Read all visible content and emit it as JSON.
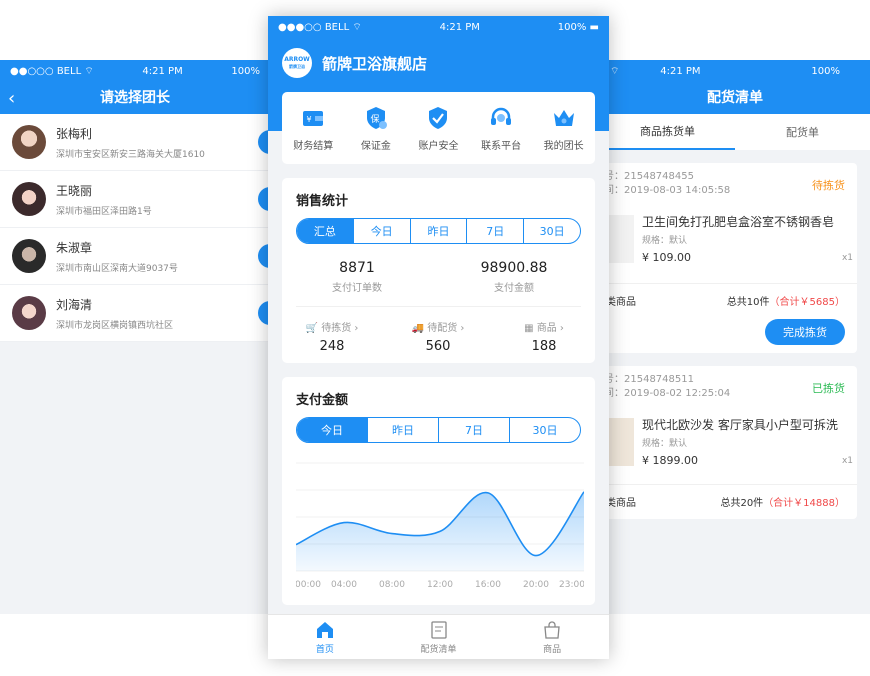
{
  "status": {
    "carrier": "BELL",
    "time": "4:21 PM",
    "battery": "100%"
  },
  "left": {
    "title": "请选择团长",
    "leaders": [
      {
        "name": "张梅利",
        "address": "深圳市宝安区新安三路海关大厦1610"
      },
      {
        "name": "王晓丽",
        "address": "深圳市福田区泽田路1号"
      },
      {
        "name": "朱淑章",
        "address": "深圳市南山区深南大道9037号"
      },
      {
        "name": "刘海清",
        "address": "深圳市龙岗区横岗镇西坑社区"
      }
    ]
  },
  "center": {
    "logo_top": "ARROW",
    "logo_bottom": "箭牌卫浴",
    "shop_name": "箭牌卫浴旗舰店",
    "menu": [
      {
        "label": "财务结算",
        "icon": "wallet-icon"
      },
      {
        "label": "保证金",
        "icon": "shield-guarantee-icon"
      },
      {
        "label": "账户安全",
        "icon": "shield-check-icon"
      },
      {
        "label": "联系平台",
        "icon": "headset-icon"
      },
      {
        "label": "我的团长",
        "icon": "crown-icon"
      }
    ],
    "sales": {
      "title": "销售统计",
      "tabs": [
        "汇总",
        "今日",
        "昨日",
        "7日",
        "30日"
      ],
      "active_tab": "汇总",
      "orders_value": "8871",
      "orders_label": "支付订单数",
      "amount_value": "98900.88",
      "amount_label": "支付金额",
      "pending_pick_label": "待拣货",
      "pending_pick_value": "248",
      "pending_ship_label": "待配货",
      "pending_ship_value": "560",
      "goods_label": "商品",
      "goods_value": "188",
      "arrow": "›"
    },
    "payment": {
      "title": "支付金额",
      "tabs": [
        "今日",
        "昨日",
        "7日",
        "30日"
      ],
      "active_tab": "今日"
    },
    "tabbar": [
      {
        "label": "首页",
        "icon": "home-icon",
        "active": true
      },
      {
        "label": "配货清单",
        "icon": "list-icon",
        "active": false
      },
      {
        "label": "商品",
        "icon": "bag-icon",
        "active": false
      }
    ]
  },
  "chart_data": {
    "type": "area",
    "x": [
      "00:00",
      "04:00",
      "08:00",
      "12:00",
      "16:00",
      "20:00",
      "23:00"
    ],
    "y": [
      24,
      44,
      34,
      36,
      71,
      14,
      72
    ],
    "ylim": [
      0,
      100
    ],
    "grid": true,
    "color": "#1e8ef3"
  },
  "right": {
    "title": "配货清单",
    "tabs": [
      "商品拣货单",
      "配货单"
    ],
    "active_tab": "商品拣货单",
    "orders": [
      {
        "order_no": "号：21548748455",
        "order_time": "间：2019-08-03  14:05:58",
        "status": "待拣货",
        "status_color": "#f7931e",
        "title": "卫生间免打孔肥皂盒浴室不锈钢香皂",
        "spec": "规格：默认",
        "price": "¥ 109.00",
        "qty": "x1",
        "category": "类商品",
        "total_prefix": "总共10件",
        "total_amount": "（合计￥5685）",
        "button": "完成拣货"
      },
      {
        "order_no": "号：21548748511",
        "order_time": "间：2019-08-02  12:25:04",
        "status": "已拣货",
        "status_color": "#2dbb55",
        "title": "现代北欧沙发 客厅家具小户型可拆洗",
        "spec": "规格：默认",
        "price": "¥ 1899.00",
        "qty": "x1",
        "category": "类商品",
        "total_prefix": "总共20件",
        "total_amount": "（合计￥14888）"
      }
    ]
  }
}
